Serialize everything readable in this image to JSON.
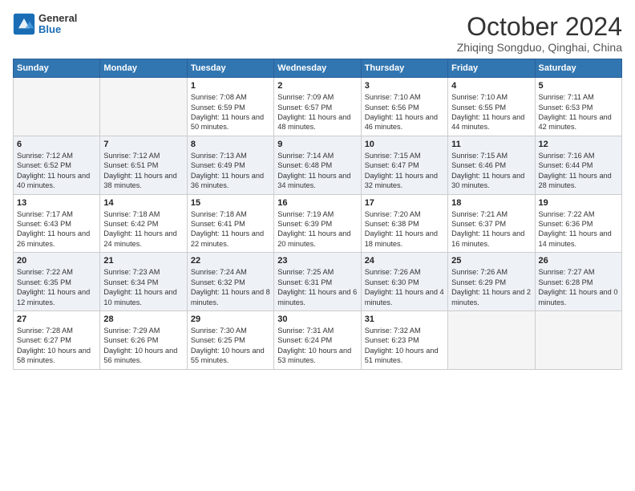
{
  "header": {
    "logo_line1": "General",
    "logo_line2": "Blue",
    "month": "October 2024",
    "location": "Zhiqing Songduo, Qinghai, China"
  },
  "weekdays": [
    "Sunday",
    "Monday",
    "Tuesday",
    "Wednesday",
    "Thursday",
    "Friday",
    "Saturday"
  ],
  "weeks": [
    [
      {
        "day": "",
        "empty": true
      },
      {
        "day": "",
        "empty": true
      },
      {
        "day": "1",
        "sunrise": "Sunrise: 7:08 AM",
        "sunset": "Sunset: 6:59 PM",
        "daylight": "Daylight: 11 hours and 50 minutes."
      },
      {
        "day": "2",
        "sunrise": "Sunrise: 7:09 AM",
        "sunset": "Sunset: 6:57 PM",
        "daylight": "Daylight: 11 hours and 48 minutes."
      },
      {
        "day": "3",
        "sunrise": "Sunrise: 7:10 AM",
        "sunset": "Sunset: 6:56 PM",
        "daylight": "Daylight: 11 hours and 46 minutes."
      },
      {
        "day": "4",
        "sunrise": "Sunrise: 7:10 AM",
        "sunset": "Sunset: 6:55 PM",
        "daylight": "Daylight: 11 hours and 44 minutes."
      },
      {
        "day": "5",
        "sunrise": "Sunrise: 7:11 AM",
        "sunset": "Sunset: 6:53 PM",
        "daylight": "Daylight: 11 hours and 42 minutes."
      }
    ],
    [
      {
        "day": "6",
        "sunrise": "Sunrise: 7:12 AM",
        "sunset": "Sunset: 6:52 PM",
        "daylight": "Daylight: 11 hours and 40 minutes."
      },
      {
        "day": "7",
        "sunrise": "Sunrise: 7:12 AM",
        "sunset": "Sunset: 6:51 PM",
        "daylight": "Daylight: 11 hours and 38 minutes."
      },
      {
        "day": "8",
        "sunrise": "Sunrise: 7:13 AM",
        "sunset": "Sunset: 6:49 PM",
        "daylight": "Daylight: 11 hours and 36 minutes."
      },
      {
        "day": "9",
        "sunrise": "Sunrise: 7:14 AM",
        "sunset": "Sunset: 6:48 PM",
        "daylight": "Daylight: 11 hours and 34 minutes."
      },
      {
        "day": "10",
        "sunrise": "Sunrise: 7:15 AM",
        "sunset": "Sunset: 6:47 PM",
        "daylight": "Daylight: 11 hours and 32 minutes."
      },
      {
        "day": "11",
        "sunrise": "Sunrise: 7:15 AM",
        "sunset": "Sunset: 6:46 PM",
        "daylight": "Daylight: 11 hours and 30 minutes."
      },
      {
        "day": "12",
        "sunrise": "Sunrise: 7:16 AM",
        "sunset": "Sunset: 6:44 PM",
        "daylight": "Daylight: 11 hours and 28 minutes."
      }
    ],
    [
      {
        "day": "13",
        "sunrise": "Sunrise: 7:17 AM",
        "sunset": "Sunset: 6:43 PM",
        "daylight": "Daylight: 11 hours and 26 minutes."
      },
      {
        "day": "14",
        "sunrise": "Sunrise: 7:18 AM",
        "sunset": "Sunset: 6:42 PM",
        "daylight": "Daylight: 11 hours and 24 minutes."
      },
      {
        "day": "15",
        "sunrise": "Sunrise: 7:18 AM",
        "sunset": "Sunset: 6:41 PM",
        "daylight": "Daylight: 11 hours and 22 minutes."
      },
      {
        "day": "16",
        "sunrise": "Sunrise: 7:19 AM",
        "sunset": "Sunset: 6:39 PM",
        "daylight": "Daylight: 11 hours and 20 minutes."
      },
      {
        "day": "17",
        "sunrise": "Sunrise: 7:20 AM",
        "sunset": "Sunset: 6:38 PM",
        "daylight": "Daylight: 11 hours and 18 minutes."
      },
      {
        "day": "18",
        "sunrise": "Sunrise: 7:21 AM",
        "sunset": "Sunset: 6:37 PM",
        "daylight": "Daylight: 11 hours and 16 minutes."
      },
      {
        "day": "19",
        "sunrise": "Sunrise: 7:22 AM",
        "sunset": "Sunset: 6:36 PM",
        "daylight": "Daylight: 11 hours and 14 minutes."
      }
    ],
    [
      {
        "day": "20",
        "sunrise": "Sunrise: 7:22 AM",
        "sunset": "Sunset: 6:35 PM",
        "daylight": "Daylight: 11 hours and 12 minutes."
      },
      {
        "day": "21",
        "sunrise": "Sunrise: 7:23 AM",
        "sunset": "Sunset: 6:34 PM",
        "daylight": "Daylight: 11 hours and 10 minutes."
      },
      {
        "day": "22",
        "sunrise": "Sunrise: 7:24 AM",
        "sunset": "Sunset: 6:32 PM",
        "daylight": "Daylight: 11 hours and 8 minutes."
      },
      {
        "day": "23",
        "sunrise": "Sunrise: 7:25 AM",
        "sunset": "Sunset: 6:31 PM",
        "daylight": "Daylight: 11 hours and 6 minutes."
      },
      {
        "day": "24",
        "sunrise": "Sunrise: 7:26 AM",
        "sunset": "Sunset: 6:30 PM",
        "daylight": "Daylight: 11 hours and 4 minutes."
      },
      {
        "day": "25",
        "sunrise": "Sunrise: 7:26 AM",
        "sunset": "Sunset: 6:29 PM",
        "daylight": "Daylight: 11 hours and 2 minutes."
      },
      {
        "day": "26",
        "sunrise": "Sunrise: 7:27 AM",
        "sunset": "Sunset: 6:28 PM",
        "daylight": "Daylight: 11 hours and 0 minutes."
      }
    ],
    [
      {
        "day": "27",
        "sunrise": "Sunrise: 7:28 AM",
        "sunset": "Sunset: 6:27 PM",
        "daylight": "Daylight: 10 hours and 58 minutes."
      },
      {
        "day": "28",
        "sunrise": "Sunrise: 7:29 AM",
        "sunset": "Sunset: 6:26 PM",
        "daylight": "Daylight: 10 hours and 56 minutes."
      },
      {
        "day": "29",
        "sunrise": "Sunrise: 7:30 AM",
        "sunset": "Sunset: 6:25 PM",
        "daylight": "Daylight: 10 hours and 55 minutes."
      },
      {
        "day": "30",
        "sunrise": "Sunrise: 7:31 AM",
        "sunset": "Sunset: 6:24 PM",
        "daylight": "Daylight: 10 hours and 53 minutes."
      },
      {
        "day": "31",
        "sunrise": "Sunrise: 7:32 AM",
        "sunset": "Sunset: 6:23 PM",
        "daylight": "Daylight: 10 hours and 51 minutes."
      },
      {
        "day": "",
        "empty": true
      },
      {
        "day": "",
        "empty": true
      }
    ]
  ]
}
